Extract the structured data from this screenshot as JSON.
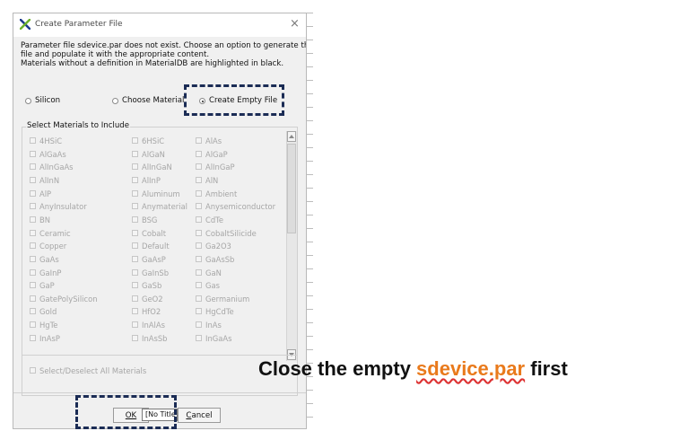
{
  "dialog": {
    "title": "Create Parameter File",
    "close_glyph": "×",
    "message_lines": [
      "Parameter file sdevice.par does not exist. Choose an option to generate this",
      "file and populate it with the appropriate content.",
      "Materials without a definition in MaterialDB are highlighted in black."
    ],
    "options": [
      {
        "label": "Silicon",
        "selected": false
      },
      {
        "label": "Choose Material",
        "selected": false
      },
      {
        "label": "Create Empty File",
        "selected": true
      }
    ],
    "group_label": "Select Materials to Include",
    "materials": [
      [
        "4HSiC",
        "6HSiC",
        "AlAs"
      ],
      [
        "AlGaAs",
        "AlGaN",
        "AlGaP"
      ],
      [
        "AlInGaAs",
        "AlInGaN",
        "AlInGaP"
      ],
      [
        "AlInN",
        "AlInP",
        "AlN"
      ],
      [
        "AlP",
        "Aluminum",
        "Ambient"
      ],
      [
        "AnyInsulator",
        "Anymaterial",
        "Anysemiconductor"
      ],
      [
        "BN",
        "BSG",
        "CdTe"
      ],
      [
        "Ceramic",
        "Cobalt",
        "CobaltSilicide"
      ],
      [
        "Copper",
        "Default",
        "Ga2O3"
      ],
      [
        "GaAs",
        "GaAsP",
        "GaAsSb"
      ],
      [
        "GaInP",
        "GaInSb",
        "GaN"
      ],
      [
        "GaP",
        "GaSb",
        "Gas"
      ],
      [
        "GatePolySilicon",
        "GeO2",
        "Germanium"
      ],
      [
        "Gold",
        "HfO2",
        "HgCdTe"
      ],
      [
        "HgTe",
        "InAlAs",
        "InAs"
      ],
      [
        "InAsP",
        "InAsSb",
        "InGaAs"
      ]
    ],
    "select_all_label": "Select/Deselect All Materials",
    "buttons": {
      "ok": "OK",
      "cancel": "Cancel"
    },
    "tooltip": "[No Title]"
  },
  "caption": {
    "before": "Close the empty ",
    "file": "sdevice.par",
    "after": " first"
  },
  "colors": {
    "highlight_dash": "#1b2c55",
    "caption_file": "#e97a1c",
    "disabled_text": "#a6a6a6"
  },
  "icons": {
    "app_logo": "x-logo-icon",
    "close": "close-icon"
  }
}
